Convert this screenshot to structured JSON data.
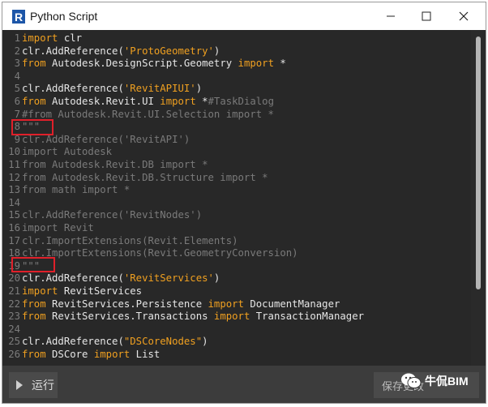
{
  "window": {
    "title": "Python Script"
  },
  "editor": {
    "lines": [
      {
        "n": "1",
        "t": [
          [
            "k",
            "import"
          ],
          [
            "c",
            " clr"
          ]
        ]
      },
      {
        "n": "2",
        "t": [
          [
            "c",
            "clr.AddReference("
          ],
          [
            "s",
            "'ProtoGeometry'"
          ],
          [
            "c",
            ")"
          ]
        ]
      },
      {
        "n": "3",
        "t": [
          [
            "k",
            "from"
          ],
          [
            "c",
            " Autodesk.DesignScript.Geometry "
          ],
          [
            "k",
            "import"
          ],
          [
            "c",
            " *"
          ]
        ]
      },
      {
        "n": "4",
        "t": []
      },
      {
        "n": "5",
        "t": [
          [
            "c",
            "clr.AddReference("
          ],
          [
            "s",
            "'RevitAPIUI'"
          ],
          [
            "c",
            ")"
          ]
        ]
      },
      {
        "n": "6",
        "t": [
          [
            "k",
            "from"
          ],
          [
            "c",
            " Autodesk.Revit.UI "
          ],
          [
            "k",
            "import"
          ],
          [
            "c",
            " *"
          ],
          [
            "cmt",
            "#TaskDialog"
          ]
        ]
      },
      {
        "n": "7",
        "t": [
          [
            "cmt",
            "#from Autodesk.Revit.UI.Selection import *"
          ]
        ]
      },
      {
        "n": "8",
        "t": [
          [
            "cmt",
            "\"\"\""
          ]
        ]
      },
      {
        "n": "9",
        "t": [
          [
            "cmt",
            "clr.AddReference('RevitAPI')"
          ]
        ]
      },
      {
        "n": "10",
        "t": [
          [
            "cmt",
            "import Autodesk"
          ]
        ]
      },
      {
        "n": "11",
        "t": [
          [
            "cmt",
            "from Autodesk.Revit.DB import *"
          ]
        ]
      },
      {
        "n": "12",
        "t": [
          [
            "cmt",
            "from Autodesk.Revit.DB.Structure import *"
          ]
        ]
      },
      {
        "n": "13",
        "t": [
          [
            "cmt",
            "from math import *"
          ]
        ]
      },
      {
        "n": "14",
        "t": []
      },
      {
        "n": "15",
        "t": [
          [
            "cmt",
            "clr.AddReference('RevitNodes')"
          ]
        ]
      },
      {
        "n": "16",
        "t": [
          [
            "cmt",
            "import Revit"
          ]
        ]
      },
      {
        "n": "17",
        "t": [
          [
            "cmt",
            "clr.ImportExtensions(Revit.Elements)"
          ]
        ]
      },
      {
        "n": "18",
        "t": [
          [
            "cmt",
            "clr.ImportExtensions(Revit.GeometryConversion)"
          ]
        ]
      },
      {
        "n": "19",
        "t": [
          [
            "cmt",
            "\"\"\""
          ]
        ]
      },
      {
        "n": "20",
        "t": [
          [
            "c",
            "clr.AddReference("
          ],
          [
            "s",
            "'RevitServices'"
          ],
          [
            "c",
            ")"
          ]
        ]
      },
      {
        "n": "21",
        "t": [
          [
            "k",
            "import"
          ],
          [
            "c",
            " RevitServices"
          ]
        ]
      },
      {
        "n": "22",
        "t": [
          [
            "k",
            "from"
          ],
          [
            "c",
            " RevitServices.Persistence "
          ],
          [
            "k",
            "import"
          ],
          [
            "c",
            " DocumentManager"
          ]
        ]
      },
      {
        "n": "23",
        "t": [
          [
            "k",
            "from"
          ],
          [
            "c",
            " RevitServices.Transactions "
          ],
          [
            "k",
            "import"
          ],
          [
            "c",
            " TransactionManager"
          ]
        ]
      },
      {
        "n": "24",
        "t": []
      },
      {
        "n": "25",
        "t": [
          [
            "c",
            "clr.AddReference("
          ],
          [
            "s",
            "\"DSCoreNodes\""
          ],
          [
            "c",
            ")"
          ]
        ]
      },
      {
        "n": "26",
        "t": [
          [
            "k",
            "from"
          ],
          [
            "c",
            " DSCore "
          ],
          [
            "k",
            "import"
          ],
          [
            "c",
            " List"
          ]
        ]
      }
    ]
  },
  "footer": {
    "run_label": "运行",
    "save_label": "保存更改",
    "watermark": "牛侃BIM"
  },
  "colors": {
    "keyword": "#f0a020",
    "string": "#f0a020",
    "comment": "#7a7a7a",
    "highlight": "#e0202a"
  }
}
